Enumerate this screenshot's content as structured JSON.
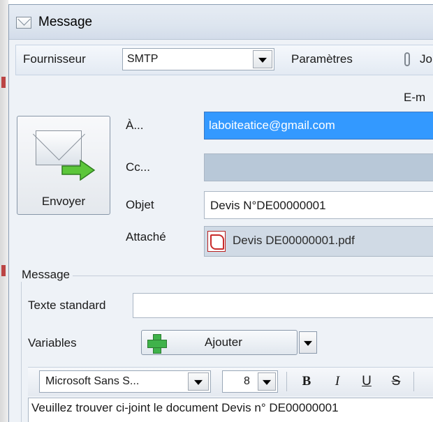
{
  "window": {
    "title": "Message",
    "icon": "envelope-icon"
  },
  "toolbar": {
    "provider_label": "Fournisseur",
    "provider_value": "SMTP",
    "params_label": "Paramètres",
    "attach_label": "Jo"
  },
  "header": {
    "email_label": "E-m"
  },
  "send": {
    "label": "Envoyer",
    "icon": "send-mail-icon"
  },
  "fields": {
    "to_label": "À...",
    "to_value": "laboiteatice@gmail.com",
    "cc_label": "Cc...",
    "cc_value": "",
    "subject_label": "Objet",
    "subject_value": "Devis N°DE00000001",
    "attached_label": "Attaché",
    "attached_value": "Devis DE00000001.pdf"
  },
  "message": {
    "group_label": "Message",
    "standard_text_label": "Texte standard",
    "standard_text_value": "",
    "variables_label": "Variables",
    "add_label": "Ajouter"
  },
  "format": {
    "font_value": "Microsoft Sans S...",
    "size_value": "8",
    "bold": "B",
    "italic": "I",
    "underline": "U",
    "strike": "S"
  },
  "body": {
    "text": "Veuillez trouver ci-joint le document Devis n° DE00000001"
  },
  "colors": {
    "selection": "#3399ff",
    "window_bg": "#eef2f7"
  }
}
